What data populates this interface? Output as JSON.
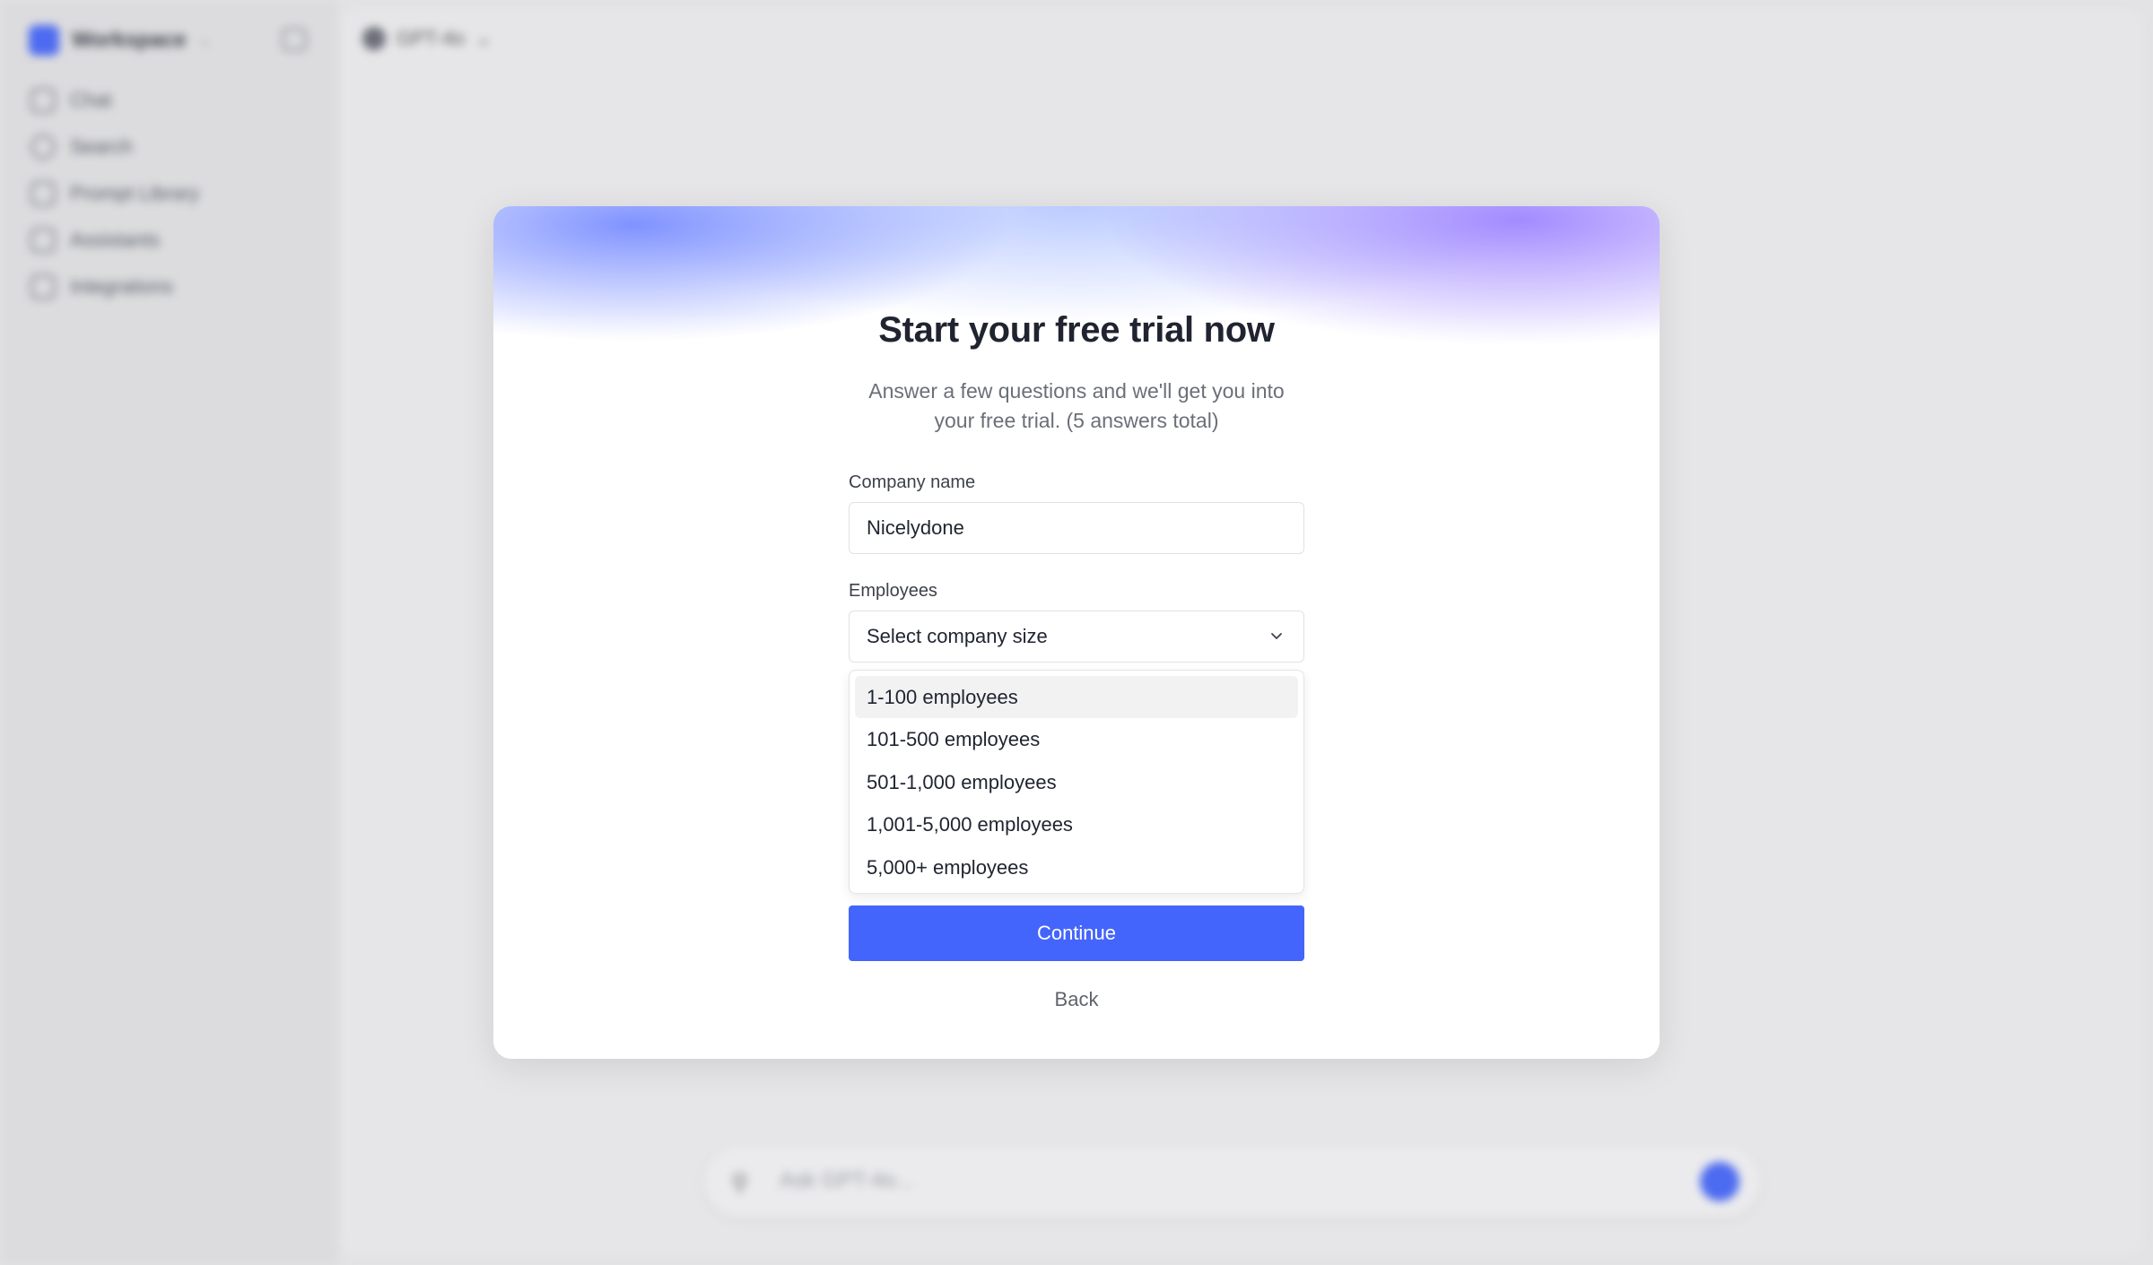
{
  "background": {
    "workspace_name": "Workspace",
    "nav_items": [
      {
        "label": "Chat",
        "icon": "pen-icon"
      },
      {
        "label": "Search",
        "icon": "search-icon"
      },
      {
        "label": "Prompt Library",
        "icon": "library-icon"
      },
      {
        "label": "Assistants",
        "icon": "assistants-icon"
      },
      {
        "label": "Integrations",
        "icon": "integrations-icon"
      }
    ],
    "model_name": "GPT-4o",
    "composer_placeholder": "Ask GPT-4o..."
  },
  "modal": {
    "title": "Start your free trial now",
    "subtitle": "Answer a few questions and we'll get you into your free trial. (5 answers total)",
    "company_field": {
      "label": "Company name",
      "value": "Nicelydone"
    },
    "employees_field": {
      "label": "Employees",
      "placeholder": "Select company size",
      "options": [
        "1-100 employees",
        "101-500 employees",
        "501-1,000 employees",
        "1,001-5,000 employees",
        "5,000+ employees"
      ],
      "highlighted_index": 0
    },
    "continue_label": "Continue",
    "back_label": "Back"
  },
  "colors": {
    "primary": "#4465fb",
    "text": "#1f2430",
    "muted": "#6b6f78",
    "overlay": "#e3e3e5"
  }
}
